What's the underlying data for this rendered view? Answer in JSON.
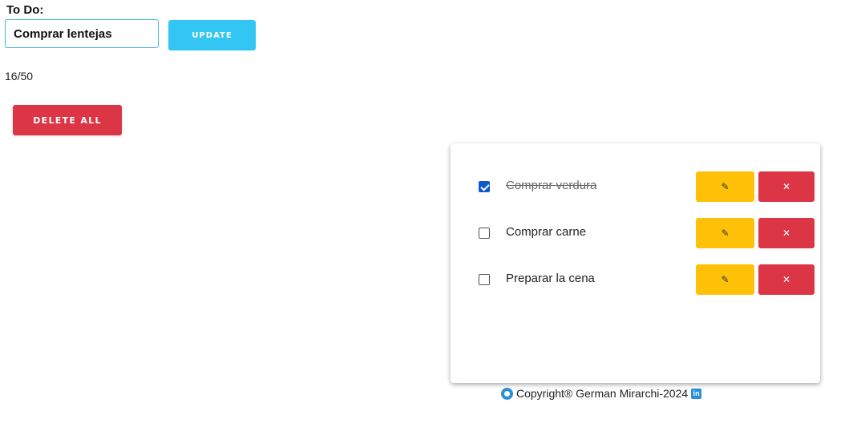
{
  "header": {
    "title": "To Do:"
  },
  "form": {
    "input_value": "Comprar lentejas",
    "update_label": "UPDATE"
  },
  "counter": "16/50",
  "delete_all_label": "DELETE ALL",
  "tasks": [
    {
      "text": "Comprar verdura",
      "done": true,
      "edit_icon": "✎",
      "remove_icon": "✕"
    },
    {
      "text": "Comprar carne",
      "done": false,
      "edit_icon": "✎",
      "remove_icon": "✕"
    },
    {
      "text": "Preparar la cena",
      "done": false,
      "edit_icon": "✎",
      "remove_icon": "✕"
    }
  ],
  "footer": {
    "copyright": "Copyright® German Mirarchi-2024",
    "linkedin_glyph": "in",
    "github_icon": "github-icon",
    "linkedin_icon": "linkedin-icon"
  },
  "colors": {
    "update": "#33c5f3",
    "danger": "#dc3545",
    "edit": "#ffc107",
    "checkbox": "#0b57d0"
  }
}
